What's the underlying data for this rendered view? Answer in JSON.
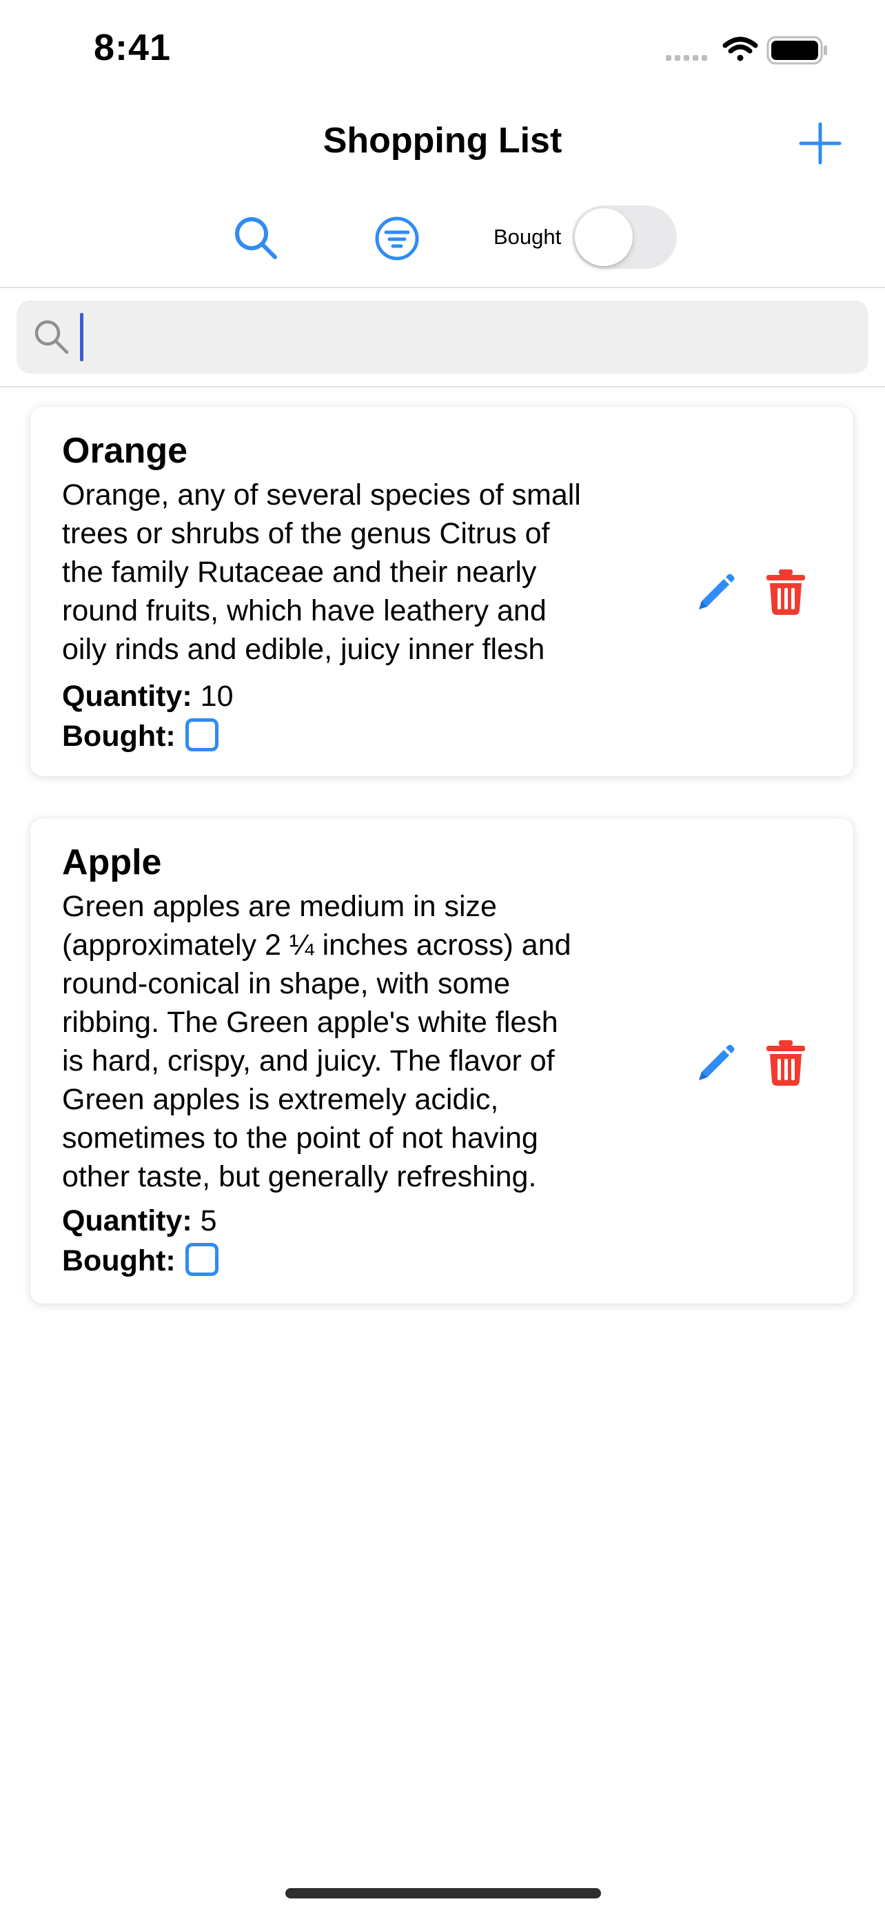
{
  "status_bar": {
    "time": "8:41",
    "icons": [
      "signal-icon",
      "wifi-icon",
      "battery-icon"
    ]
  },
  "nav": {
    "title": "Shopping List",
    "add_icon": "plus-icon"
  },
  "toolbar": {
    "search_icon": "search-icon",
    "filter_icon": "filter-icon",
    "bought_label": "Bought",
    "bought_toggle_on": false
  },
  "search": {
    "value": "",
    "placeholder": ""
  },
  "items": [
    {
      "title": "Orange",
      "description": "Orange, any of several species of small\ntrees or shrubs of the genus Citrus of\nthe family Rutaceae and their nearly\nround fruits, which have leathery and\noily rinds and edible, juicy inner flesh",
      "quantity_label": "Quantity:",
      "quantity": "10",
      "bought_label": "Bought:",
      "bought": false
    },
    {
      "title": "Apple",
      "description": "Green apples are medium in size\n(approximately 2 ¼ inches across) and\nround-conical in shape, with some\nribbing. The Green apple's white flesh\nis hard, crispy, and juicy. The flavor of\nGreen apples is extremely acidic,\nsometimes to the point of not having\nother taste, but generally refreshing.",
      "quantity_label": "Quantity:",
      "quantity": "5",
      "bought_label": "Bought:",
      "bought": false
    }
  ],
  "colors": {
    "accent": "#2f8cf2",
    "delete": "#f23b2f",
    "caret": "#3d5bd9"
  }
}
